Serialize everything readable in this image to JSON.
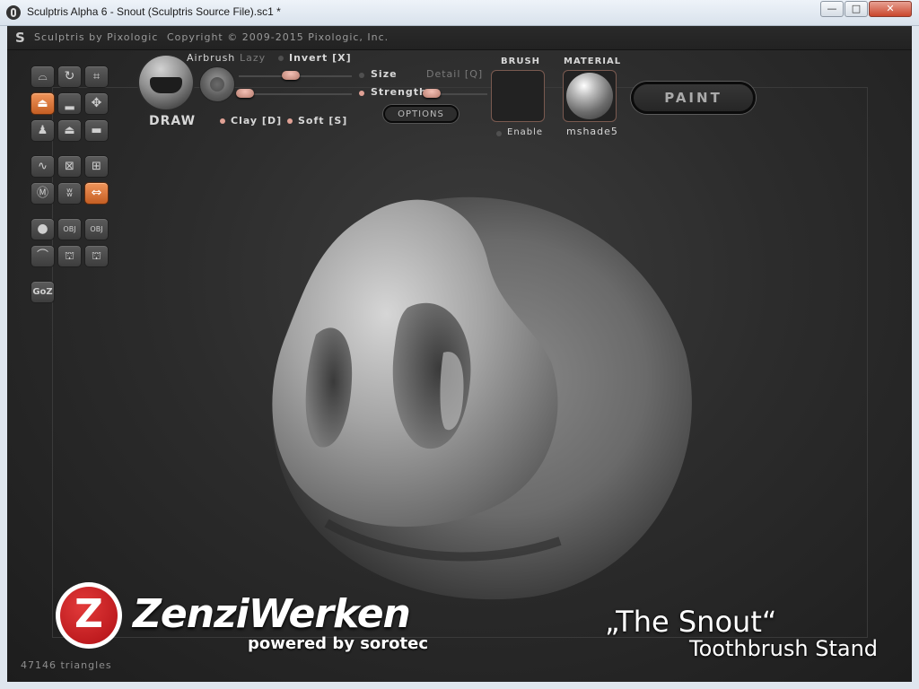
{
  "window": {
    "title": "Sculptris Alpha 6 - Snout (Sculptris Source File).sc1 *",
    "minimize_glyph": "—",
    "maximize_glyph": "□",
    "close_glyph": "✕"
  },
  "header": {
    "product": "Sculptris by Pixologic",
    "copyright": "Copyright © 2009-2015 Pixologic, Inc."
  },
  "toolbar": {
    "tool_name": "DRAW",
    "airbrush_label": "Airbrush",
    "lazy_label": "Lazy",
    "invert_label": "Invert [X]",
    "size_label": "Size",
    "detail_label": "Detail [Q]",
    "strength_label": "Strength",
    "options_label": "OPTIONS",
    "clay_label": "Clay [D]",
    "soft_label": "Soft [S]",
    "brush_label": "BRUSH",
    "enable_label": "Enable",
    "material_label": "MATERIAL",
    "material_name": "mshade5",
    "paint_label": "PAINT"
  },
  "tools": {
    "goz_label": "GoZ",
    "obj_label": "OBJ",
    "obj2_label": "OBJ"
  },
  "status": {
    "triangles": "47146 triangles"
  },
  "overlay": {
    "logo_letter": "Z",
    "brand": "ZenziWerken",
    "tagline": "powered by sorotec",
    "title": "„The Snout“",
    "subtitle": "Toothbrush Stand"
  },
  "colors": {
    "active_orange": "#d87034",
    "slider_knob": "#e7b0a3",
    "logo_red": "#c8181e"
  }
}
